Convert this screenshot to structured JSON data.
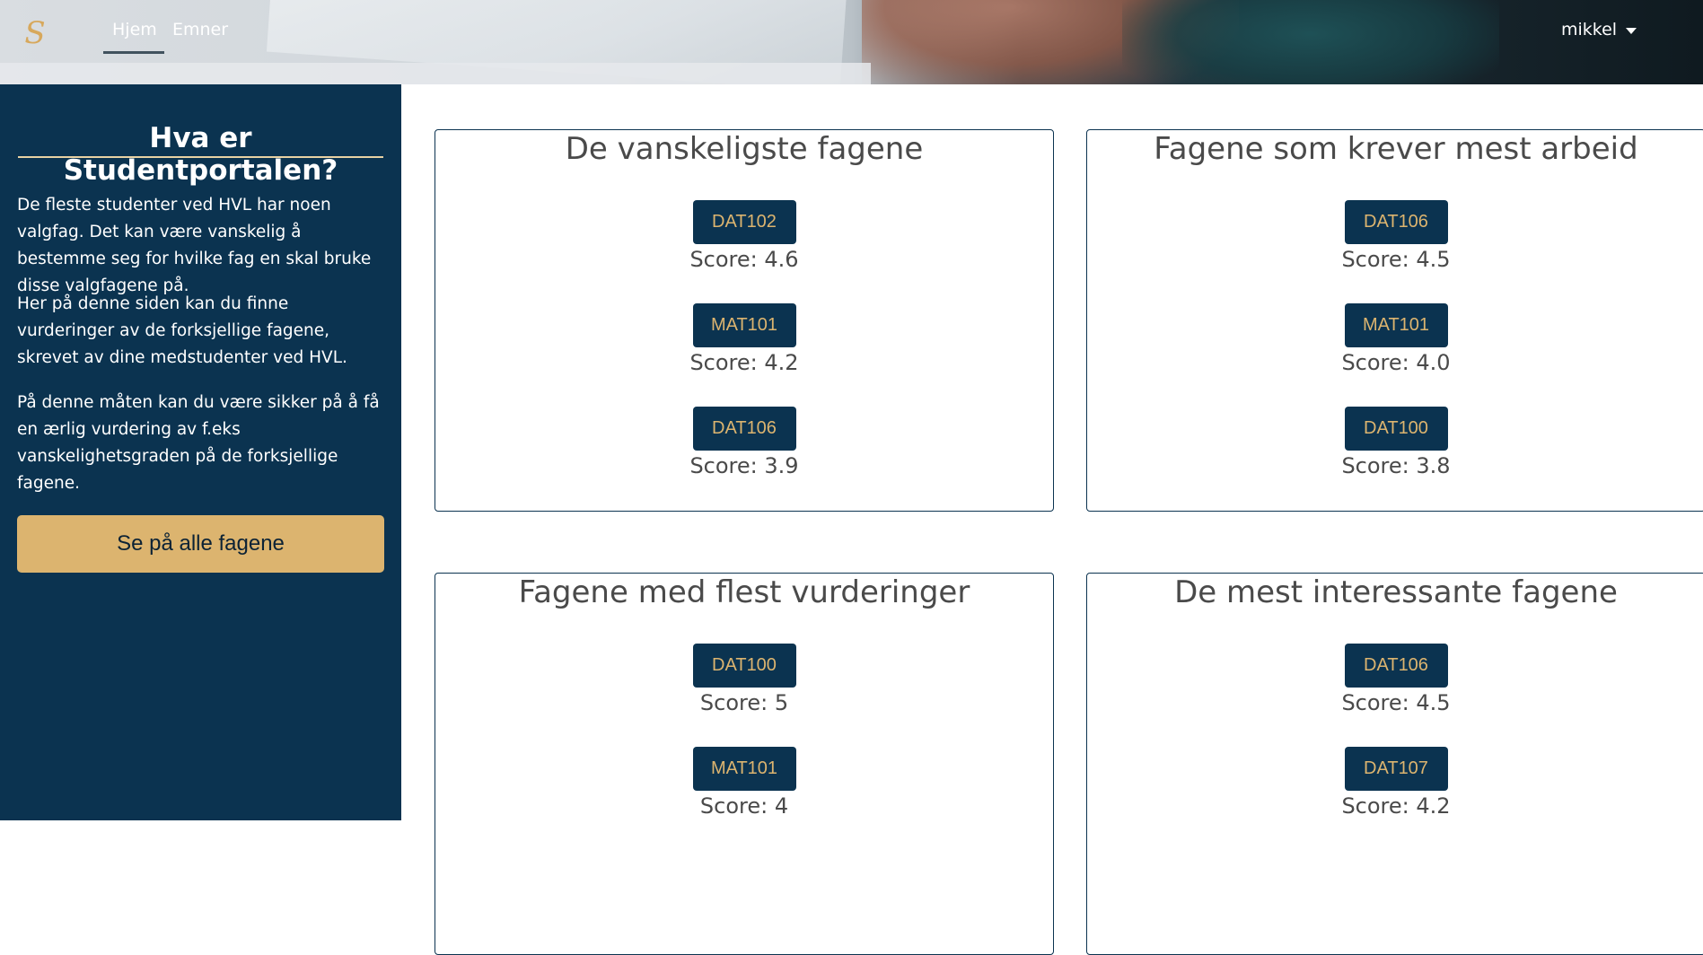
{
  "header": {
    "logo_text": "S",
    "nav": [
      {
        "label": "Hjem"
      },
      {
        "label": "Emner"
      }
    ],
    "user": "mikkel"
  },
  "sidebar": {
    "title": "Hva er Studentportalen?",
    "paragraphs": [
      "De fleste studenter ved HVL har noen valgfag. Det kan være vanskelig å bestemme seg for hvilke fag en skal bruke disse valgfagene på.",
      "Her på denne siden kan du finne vurderinger av de forksjellige fagene, skrevet av dine medstudenter ved HVL.",
      "På denne måten kan du være sikker på å få en ærlig vurdering av f.eks vanskelighetsgraden på de forksjellige fagene."
    ],
    "button_label": "Se på alle fagene"
  },
  "cards": [
    {
      "title": "De vanskeligste fagene",
      "entries": [
        {
          "code": "DAT102",
          "score": "Score: 4.6"
        },
        {
          "code": "MAT101",
          "score": "Score: 4.2"
        },
        {
          "code": "DAT106",
          "score": "Score: 3.9"
        }
      ]
    },
    {
      "title": "Fagene som krever mest arbeid",
      "entries": [
        {
          "code": "DAT106",
          "score": "Score: 4.5"
        },
        {
          "code": "MAT101",
          "score": "Score: 4.0"
        },
        {
          "code": "DAT100",
          "score": "Score: 3.8"
        }
      ]
    },
    {
      "title": "Fagene med flest vurderinger",
      "entries": [
        {
          "code": "DAT100",
          "score": "Score: 5"
        },
        {
          "code": "MAT101",
          "score": "Score: 4"
        }
      ]
    },
    {
      "title": "De mest interessante fagene",
      "entries": [
        {
          "code": "DAT106",
          "score": "Score: 4.5"
        },
        {
          "code": "DAT107",
          "score": "Score: 4.2"
        }
      ]
    }
  ],
  "colors": {
    "primary": "#0b3350",
    "accent": "#dcb46f",
    "text": "#4a4a4a"
  }
}
